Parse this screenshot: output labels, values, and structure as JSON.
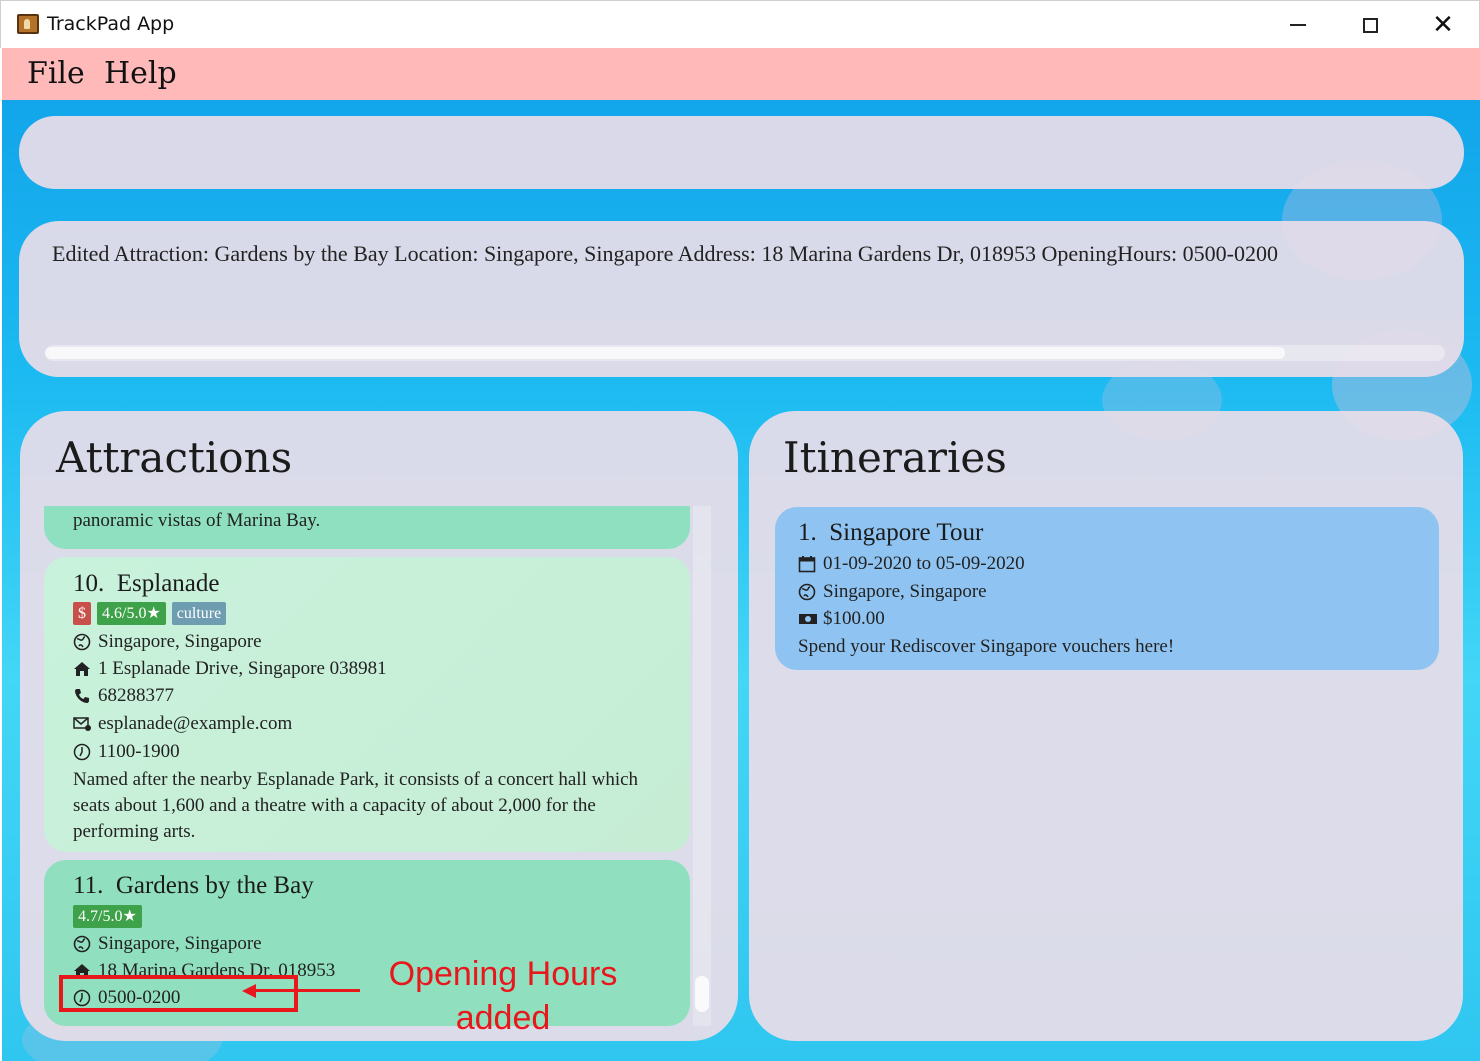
{
  "window": {
    "title": "TrackPad App",
    "min_icon": "minimize-icon",
    "max_icon": "maximize-icon",
    "close_icon": "close-icon",
    "close_glyph": "✕"
  },
  "menu": {
    "file": "File",
    "help": "Help"
  },
  "command_box": {
    "placeholder": "",
    "value": ""
  },
  "result": {
    "text": "Edited Attraction: Gardens by the Bay Location: Singapore, Singapore Address: 18 Marina Gardens Dr, 018953 OpeningHours: 0500-0200"
  },
  "attractions": {
    "heading": "Attractions",
    "prev_card_desc": "panoramic vistas of Marina Bay.",
    "items": [
      {
        "index": "10.",
        "name": "Esplanade",
        "price": "$",
        "rating": "4.6/5.0★",
        "tag": "culture",
        "location": "Singapore, Singapore",
        "address": "1 Esplanade Drive, Singapore 038981",
        "phone": "68288377",
        "email": "esplanade@example.com",
        "hours": "1100-1900",
        "description": "Named after the nearby Esplanade Park, it consists of a concert hall which seats about 1,600 and a theatre with a capacity of about 2,000 for the performing arts."
      },
      {
        "index": "11.",
        "name": "Gardens by the Bay",
        "rating": "4.7/5.0★",
        "location": "Singapore, Singapore",
        "address": "18 Marina Gardens Dr, 018953",
        "hours": "0500-0200"
      }
    ]
  },
  "itineraries": {
    "heading": "Itineraries",
    "items": [
      {
        "index": "1.",
        "name": "Singapore Tour",
        "dates": "01-09-2020 to 05-09-2020",
        "location": "Singapore, Singapore",
        "budget": "$100.00",
        "description": "Spend your Rediscover Singapore vouchers here!"
      }
    ]
  },
  "annotation": {
    "line1": "Opening Hours",
    "line2": "added",
    "color": "#e8171c"
  },
  "colors": {
    "menu_bar": "#ffb9b9",
    "rating_badge": "#3ea24a",
    "price_badge": "#c9504a",
    "tag_badge": "#6e9cb0",
    "itinerary_card": "#8fc4f2"
  }
}
